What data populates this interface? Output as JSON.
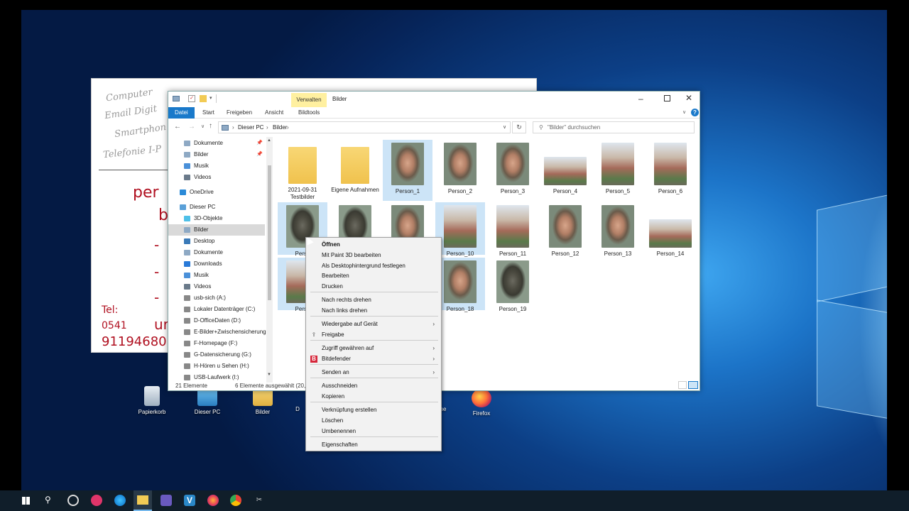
{
  "desktop": {
    "icons": [
      {
        "label": "Papierkorb"
      },
      {
        "label": "Dieser PC"
      },
      {
        "label": "Bilder"
      },
      {
        "label": "D"
      },
      {
        "label": "ne"
      },
      {
        "label": "Firefox"
      }
    ]
  },
  "bgwindow": {
    "hand_lines": [
      "Computer",
      "Email  Digit",
      "Smartphon",
      "Telefonie  I-P"
    ],
    "per": "per",
    "b": "b",
    "dashes": [
      "-",
      "-",
      "-"
    ],
    "tel": "Tel:",
    "tel_line1": "0541",
    "tel_un": "ur",
    "tel_line2": "91194680"
  },
  "explorer": {
    "title": "Bilder",
    "context_tab": "Verwalten",
    "tabs": [
      "Datei",
      "Start",
      "Freigeben",
      "Ansicht",
      "Bildtools"
    ],
    "breadcrumb": [
      "Dieser PC",
      "Bilder"
    ],
    "search_placeholder": "\"Bilder\" durchsuchen",
    "nav": [
      {
        "label": "Dokumente",
        "pinned": true
      },
      {
        "label": "Bilder",
        "pinned": true
      },
      {
        "label": "Musik"
      },
      {
        "label": "Videos"
      },
      {
        "label": "OneDrive"
      },
      {
        "label": "Dieser PC"
      },
      {
        "label": "3D-Objekte"
      },
      {
        "label": "Bilder",
        "selected": true
      },
      {
        "label": "Desktop"
      },
      {
        "label": "Dokumente"
      },
      {
        "label": "Downloads"
      },
      {
        "label": "Musik"
      },
      {
        "label": "Videos"
      },
      {
        "label": "usb-sich (A:)"
      },
      {
        "label": "Lokaler Datenträger (C:)"
      },
      {
        "label": "D-OfficeDaten (D:)"
      },
      {
        "label": "E-Bilder+Zwischensicherung"
      },
      {
        "label": "F-Homepage (F:)"
      },
      {
        "label": "G-Datensicherung (G:)"
      },
      {
        "label": "H-Hören u Sehen (H:)"
      },
      {
        "label": "USB-Laufwerk (I:)"
      }
    ],
    "files": [
      {
        "label": "2021-09-31 Testbilder",
        "kind": "folder"
      },
      {
        "label": "Eigene Aufnahmen",
        "kind": "folder"
      },
      {
        "label": "Person_1",
        "kind": "face",
        "selected": true
      },
      {
        "label": "Person_2",
        "kind": "face"
      },
      {
        "label": "Person_3",
        "kind": "face"
      },
      {
        "label": "Person_4",
        "kind": "bldg"
      },
      {
        "label": "Person_5",
        "kind": "bldg"
      },
      {
        "label": "Person_6",
        "kind": "bldg"
      },
      {
        "label": "Perso",
        "kind": "facedark",
        "selected": true
      },
      {
        "label": "",
        "kind": "facedark"
      },
      {
        "label": "",
        "kind": "face"
      },
      {
        "label": "Person_10",
        "kind": "bldg",
        "selected": true
      },
      {
        "label": "Person_11",
        "kind": "bldg"
      },
      {
        "label": "Person_12",
        "kind": "face"
      },
      {
        "label": "Person_13",
        "kind": "face"
      },
      {
        "label": "Person_14",
        "kind": "bldg"
      },
      {
        "label": "Perso",
        "kind": "bldg",
        "selected": true
      },
      {
        "label": "Person_18",
        "kind": "face",
        "selected": true
      },
      {
        "label": "Person_19",
        "kind": "facedark"
      }
    ],
    "status_count": "21 Elemente",
    "status_selected": "6 Elemente ausgewählt (20,8 MB)"
  },
  "context_menu": {
    "items": [
      {
        "label": "Öffnen",
        "bold": true
      },
      {
        "label": "Mit Paint 3D bearbeiten"
      },
      {
        "label": "Als Desktophintergrund festlegen"
      },
      {
        "label": "Bearbeiten"
      },
      {
        "label": "Drucken"
      },
      {
        "label": "Nach rechts drehen"
      },
      {
        "label": "Nach links drehen"
      },
      {
        "label": "Wiedergabe auf Gerät",
        "submenu": true
      },
      {
        "label": "Freigabe",
        "icon": "share-icon"
      },
      {
        "label": "Zugriff gewähren auf",
        "submenu": true
      },
      {
        "label": "Bitdefender",
        "icon": "bitdefender-icon",
        "submenu": true
      },
      {
        "label": "Senden an",
        "submenu": true
      },
      {
        "label": "Ausschneiden"
      },
      {
        "label": "Kopieren"
      },
      {
        "label": "Verknüpfung erstellen"
      },
      {
        "label": "Löschen"
      },
      {
        "label": "Umbenennen"
      },
      {
        "label": "Eigenschaften"
      }
    ]
  },
  "colors": {
    "accent": "#1979ca",
    "selection": "#cce4f7",
    "context_tab": "#fff0a0"
  }
}
